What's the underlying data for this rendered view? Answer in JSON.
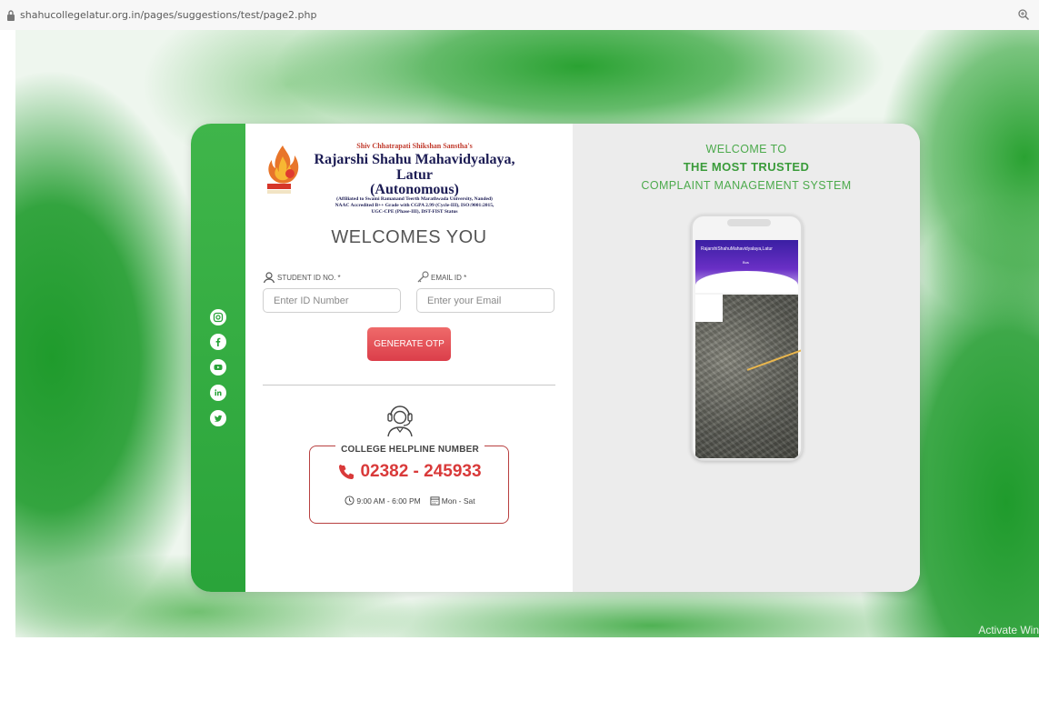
{
  "browser": {
    "url": "shahucollegelatur.org.in/pages/suggestions/test/page2.php"
  },
  "watermark": "Activate Win",
  "college": {
    "sanstha": "Shiv Chhatrapati Shikshan Sanstha's",
    "name": "Rajarshi Shahu Mahavidyalaya, Latur",
    "autonomous": "(Autonomous)",
    "affiliation": "(Affiliated to Swami Ramanand Teerth Marathwada University, Nanded)",
    "accreditation": "NAAC Accredited B++ Grade with CGPA 2.99 (Cycle-III), ISO:9001:2015,",
    "status": "UGC-CPE (Phase-III), DST-FIST Status"
  },
  "form": {
    "welcome": "WELCOMES YOU",
    "student_id_label": "STUDENT ID NO. *",
    "student_id_placeholder": "Enter ID Number",
    "email_label": "EMAIL ID *",
    "email_placeholder": "Enter your Email",
    "otp_button": "GENERATE OTP"
  },
  "helpline": {
    "title": "COLLEGE HELPLINE NUMBER",
    "number": "02382 - 245933",
    "hours": "9:00 AM - 6:00 PM",
    "days": "Mon - Sat"
  },
  "promo": {
    "line1": "WELCOME TO",
    "line2": "THE MOST TRUSTED",
    "line3": "COMPLAINT MANAGEMENT SYSTEM",
    "phone_header": "RajarshiShahuMahavidyalaya,Latur",
    "phone_sub": "Bus"
  },
  "social": [
    "instagram-icon",
    "facebook-icon",
    "youtube-icon",
    "linkedin-icon",
    "twitter-icon"
  ],
  "colors": {
    "green": "#3fb54a",
    "red": "#d93a3a",
    "button": "#e5535c",
    "promo_text": "#4caa4c"
  }
}
